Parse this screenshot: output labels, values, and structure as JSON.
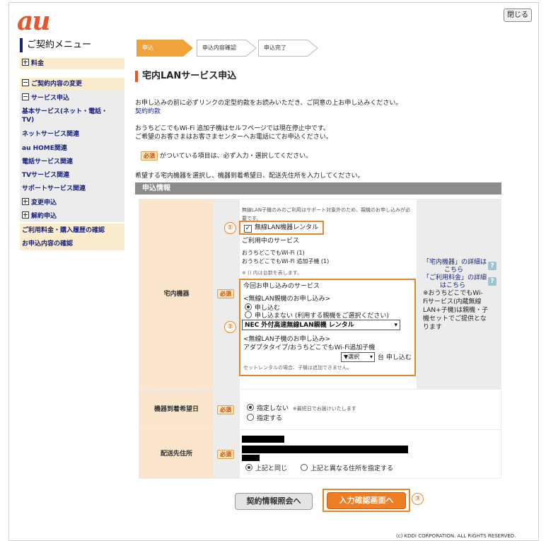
{
  "brand": {
    "logo": "au",
    "accent": "#e8552a",
    "navy": "#1a237e"
  },
  "header": {
    "close_label": "閉じる"
  },
  "sidebar": {
    "title": "ご契約メニュー",
    "items": [
      {
        "label": "料金"
      },
      {
        "label": "ご契約内容の変更"
      },
      {
        "label": "サービス申込"
      },
      {
        "label": "基本サービス(ネット・電話・TV)"
      },
      {
        "label": "ネットサービス関連"
      },
      {
        "label": "au HOME関連"
      },
      {
        "label": "電話サービス関連"
      },
      {
        "label": "TVサービス関連"
      },
      {
        "label": "サポートサービス関連"
      },
      {
        "label": "変更申込"
      },
      {
        "label": "解約申込"
      },
      {
        "label": "ご利用料金・購入履歴の確認"
      },
      {
        "label": "お申込内容の確認"
      }
    ]
  },
  "steps": [
    {
      "label": "申込",
      "active": true
    },
    {
      "label": "申込内容確認",
      "active": false
    },
    {
      "label": "申込完了",
      "active": false
    }
  ],
  "page_title": "宅内LANサービス申込",
  "intro": {
    "line1": "お申し込みの前に必ずリンクの定型約款をお読みいただき、ご同意の上お申し込みください。",
    "terms_link": "契約約款",
    "line2": "おうちどこでもWi-Fi 追加子機はセルフページでは現在停止中です。",
    "line3": "ご希望のお客さまはお客さまセンターへお電話にてお申込ください。",
    "required_badge": "必須",
    "required_note": "がついている項目は、必ず入力・選択してください。",
    "instruction": "希望する宅内機器を選択し、機器到着希望日、配送先住所を入力してください。"
  },
  "section_title": "申込情報",
  "equipment": {
    "label": "宅内機器",
    "required": "必須",
    "notice": "無線LAN子機のみのご利用はサポート対象外のため、親機のお申し込みが必要です。",
    "rental_checkbox": "無線LAN機器レンタル",
    "current_services_title": "ご利用中のサービス",
    "current_service_1": "おうちどこでもWi-Fi (1)",
    "current_service_2": "おうちどこでもWi-Fi 追加子機 (1)",
    "paren_note": "※ () 内は台数を表します。",
    "this_time_title": "今回お申し込みのサービス",
    "parent_title": "<無線LAN親機のお申し込み>",
    "apply": "申し込む",
    "no_apply": "申し込まない (利用する親機をご選択ください)",
    "parent_select": "NEC 外付高速無線LAN親機 レンタル",
    "child_title": "<無線LAN子機のお申し込み>",
    "child_sub": "アダプタタイプ/おうちどこでもWi-Fi追加子機",
    "qty_select": "▼選択",
    "qty_suffix": "台 申し込む",
    "set_note": "セットレンタルの場合、子機は追加できません。",
    "side_link_1a": "「宅内機器」の詳細は",
    "side_link_1b": "こちら",
    "side_link_2a": "「ご利用料金」の詳細",
    "side_link_2b": "はこちら",
    "side_note_1": "※おうちどこでもWi-",
    "side_note_2": "Fiサービス(内蔵無線",
    "side_note_3": "LAN+子機)は親機・子",
    "side_note_4": "機セットでご提供とな",
    "side_note_5": "ります"
  },
  "arrival": {
    "label": "機器到着希望日",
    "required": "必須",
    "opt_none": "指定しない",
    "opt_none_note": "※最短日でお届けいたします",
    "opt_specify": "指定する"
  },
  "address": {
    "label": "配送先住所",
    "required": "必須",
    "same": "上記と同じ",
    "other": "上記と異なる住所を指定する"
  },
  "buttons": {
    "back": "契約情報照会へ",
    "next": "入力確認画面へ"
  },
  "markers": [
    "①",
    "②",
    "③"
  ],
  "footer": "(c) KDDI CORPORATION. ALL RIGHTS RESERVED."
}
